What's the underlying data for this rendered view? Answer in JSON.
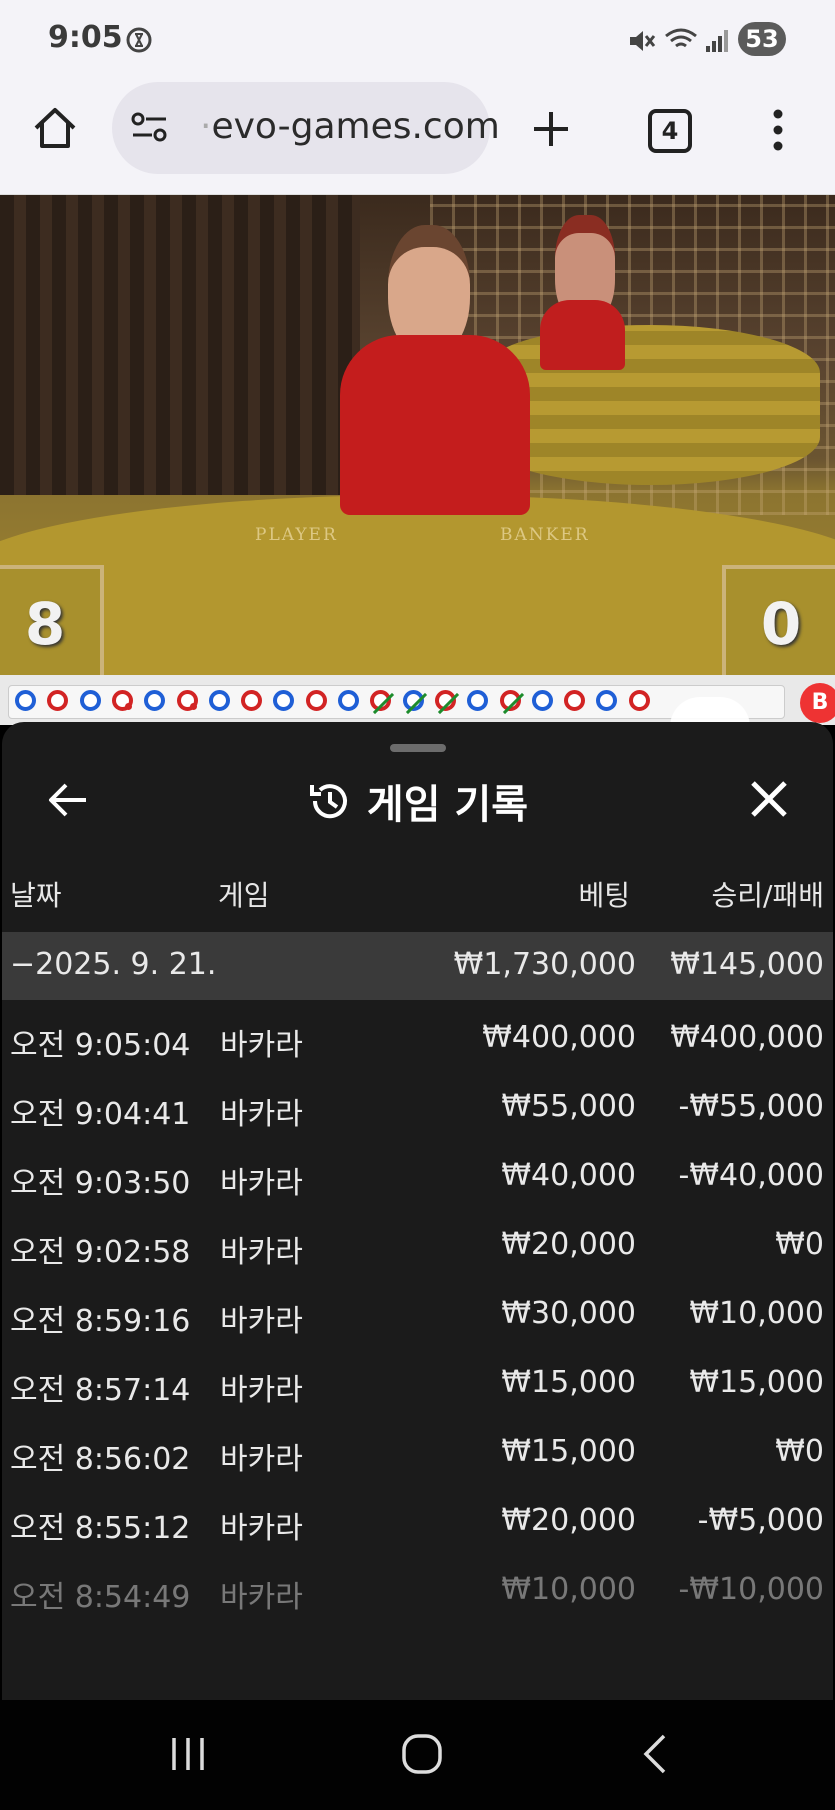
{
  "status_bar": {
    "time": "9:05",
    "battery": "53"
  },
  "browser": {
    "url": "evo-games.com",
    "url_prefix": "·",
    "tab_count": "4"
  },
  "video": {
    "table_labels": [
      "PLAYER",
      "BANKER"
    ],
    "player_score": "8",
    "banker_score": "0",
    "side_badge": "B"
  },
  "bead_road": [
    {
      "r": "player"
    },
    {
      "r": "banker"
    },
    {
      "r": "player"
    },
    {
      "r": "banker",
      "dot": true
    },
    {
      "r": "player"
    },
    {
      "r": "banker",
      "dot": true
    },
    {
      "r": "player"
    },
    {
      "r": "banker"
    },
    {
      "r": "player"
    },
    {
      "r": "banker"
    },
    {
      "r": "player"
    },
    {
      "r": "banker",
      "tie": true
    },
    {
      "r": "player",
      "tie": true
    },
    {
      "r": "banker",
      "tie": true
    },
    {
      "r": "player"
    },
    {
      "r": "banker",
      "tie": true
    },
    {
      "r": "player"
    },
    {
      "r": "banker"
    },
    {
      "r": "player"
    },
    {
      "r": "banker"
    }
  ],
  "panel": {
    "title": "게임 기록",
    "columns": {
      "date": "날짜",
      "game": "게임",
      "bet": "베팅",
      "winloss": "승리/패배"
    },
    "summary": {
      "date": "−2025. 9. 21.",
      "bet": "₩1,730,000",
      "winloss": "₩145,000"
    },
    "rows": [
      {
        "time": "오전 9:05:04",
        "game": "바카라",
        "bet": "₩400,000",
        "winloss": "₩400,000"
      },
      {
        "time": "오전 9:04:41",
        "game": "바카라",
        "bet": "₩55,000",
        "winloss": "-₩55,000"
      },
      {
        "time": "오전 9:03:50",
        "game": "바카라",
        "bet": "₩40,000",
        "winloss": "-₩40,000"
      },
      {
        "time": "오전 9:02:58",
        "game": "바카라",
        "bet": "₩20,000",
        "winloss": "₩0"
      },
      {
        "time": "오전 8:59:16",
        "game": "바카라",
        "bet": "₩30,000",
        "winloss": "₩10,000"
      },
      {
        "time": "오전 8:57:14",
        "game": "바카라",
        "bet": "₩15,000",
        "winloss": "₩15,000"
      },
      {
        "time": "오전 8:56:02",
        "game": "바카라",
        "bet": "₩15,000",
        "winloss": "₩0"
      },
      {
        "time": "오전 8:55:12",
        "game": "바카라",
        "bet": "₩20,000",
        "winloss": "-₩5,000"
      },
      {
        "time": "오전 8:54:49",
        "game": "바카라",
        "bet": "₩10,000",
        "winloss": "-₩10,000"
      }
    ]
  },
  "icons": [
    "home-icon",
    "site-settings-icon",
    "new-tab-icon",
    "tab-switcher-icon",
    "overflow-menu-icon",
    "back-arrow-icon",
    "history-icon",
    "close-icon",
    "recents-nav-icon",
    "home-nav-icon",
    "back-nav-icon"
  ]
}
